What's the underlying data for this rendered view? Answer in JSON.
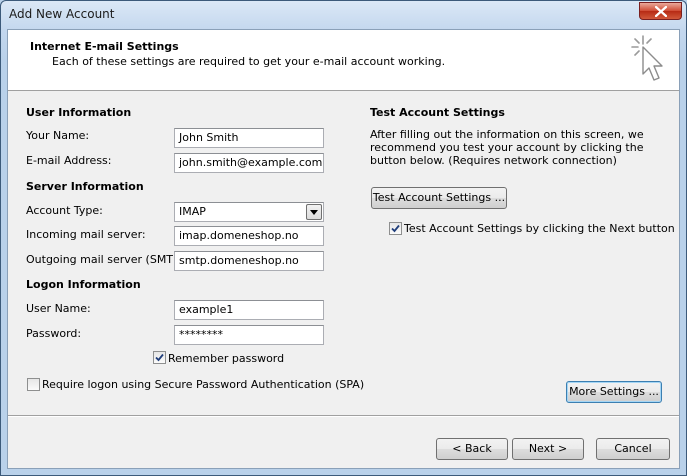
{
  "window": {
    "title": "Add New Account"
  },
  "header": {
    "title": "Internet E-mail Settings",
    "subtitle": "Each of these settings are required to get your e-mail account working."
  },
  "user_info": {
    "heading": "User Information",
    "name_label": "Your Name:",
    "name_value": "John Smith",
    "email_label": "E-mail Address:",
    "email_value": "john.smith@example.com"
  },
  "server_info": {
    "heading": "Server Information",
    "account_type_label": "Account Type:",
    "account_type_value": "IMAP",
    "incoming_label": "Incoming mail server:",
    "incoming_value": "imap.domeneshop.no",
    "outgoing_label": "Outgoing mail server (SMTP):",
    "outgoing_value": "smtp.domeneshop.no"
  },
  "logon_info": {
    "heading": "Logon Information",
    "username_label": "User Name:",
    "username_value": "example1",
    "password_label": "Password:",
    "password_value": "********",
    "remember_label": "Remember password",
    "remember_checked": true,
    "spa_label": "Require logon using Secure Password Authentication (SPA)",
    "spa_checked": false
  },
  "test_settings": {
    "heading": "Test Account Settings",
    "description": "After filling out the information on this screen, we recommend you test your account by clicking the button below. (Requires network connection)",
    "test_button": "Test Account Settings ...",
    "next_check_label": "Test Account Settings by clicking the Next button",
    "next_check_checked": true
  },
  "buttons": {
    "more_settings": "More Settings ...",
    "back": "< Back",
    "next": "Next >",
    "cancel": "Cancel"
  },
  "icons": {
    "close": "close-icon",
    "dropdown": "chevron-down-icon",
    "wizard": "cursor-sparkle-icon"
  }
}
